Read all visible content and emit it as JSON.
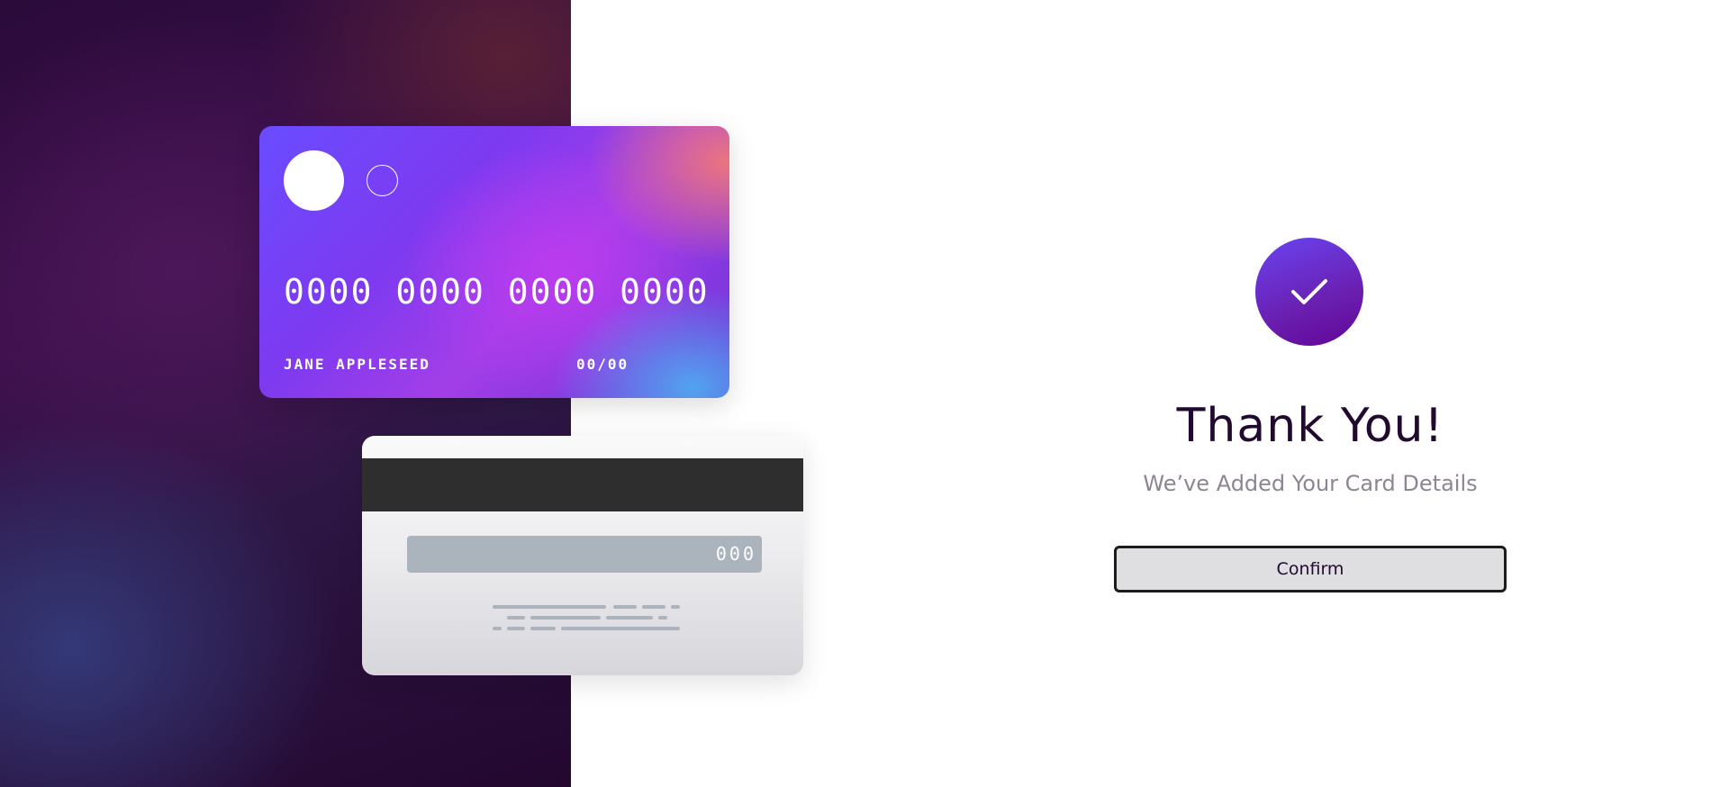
{
  "cards": {
    "front": {
      "number": "0000 0000 0000 0000",
      "holder": "JANE APPLESEED",
      "expiry": "00/00"
    },
    "back": {
      "cvc": "000"
    }
  },
  "completion": {
    "icon": "checkmark-icon",
    "title": "Thank You!",
    "subtitle": "We’ve Added Your Card Details",
    "confirm_label": "Confirm"
  },
  "colors": {
    "accent_start": "#6a44f2",
    "accent_end": "#610595",
    "heading": "#21092f",
    "muted_text": "#8e8593"
  }
}
